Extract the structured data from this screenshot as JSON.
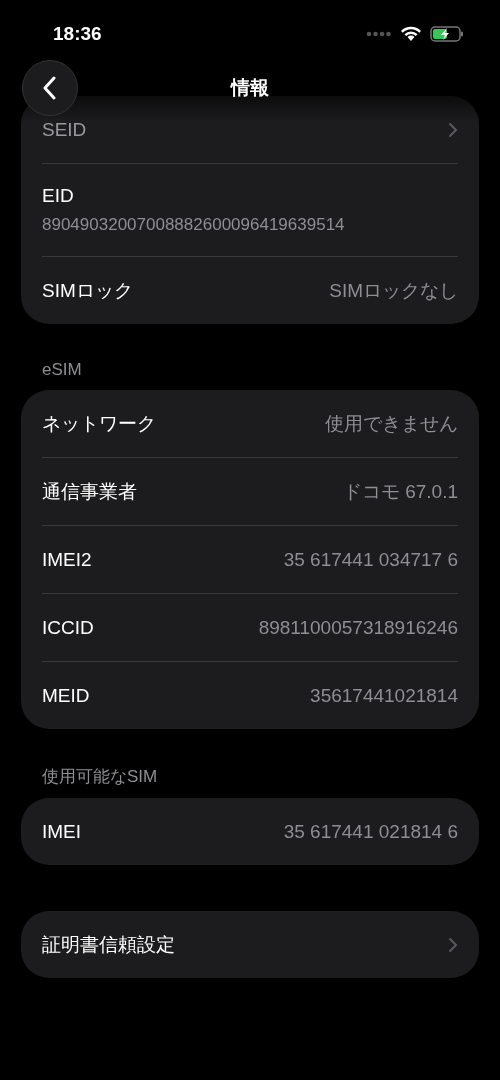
{
  "status_bar": {
    "time": "18:36"
  },
  "nav": {
    "title": "情報"
  },
  "sections": [
    {
      "rows": [
        {
          "kind": "link",
          "label": "SEID"
        },
        {
          "kind": "stacked",
          "label": "EID",
          "value": "89049032007008882600096419639514"
        },
        {
          "kind": "value",
          "label": "SIMロック",
          "value": "SIMロックなし"
        }
      ]
    },
    {
      "header": "eSIM",
      "rows": [
        {
          "kind": "value",
          "label": "ネットワーク",
          "value": "使用できません"
        },
        {
          "kind": "value",
          "label": "通信事業者",
          "value": "ドコモ 67.0.1"
        },
        {
          "kind": "value",
          "label": "IMEI2",
          "value": "35 617441 034717 6"
        },
        {
          "kind": "value",
          "label": "ICCID",
          "value": "8981100057318916246"
        },
        {
          "kind": "value",
          "label": "MEID",
          "value": "35617441021814"
        }
      ]
    },
    {
      "header": "使用可能なSIM",
      "rows": [
        {
          "kind": "value",
          "label": "IMEI",
          "value": "35 617441 021814 6"
        }
      ]
    },
    {
      "rows": [
        {
          "kind": "link",
          "label": "証明書信頼設定"
        }
      ]
    }
  ]
}
